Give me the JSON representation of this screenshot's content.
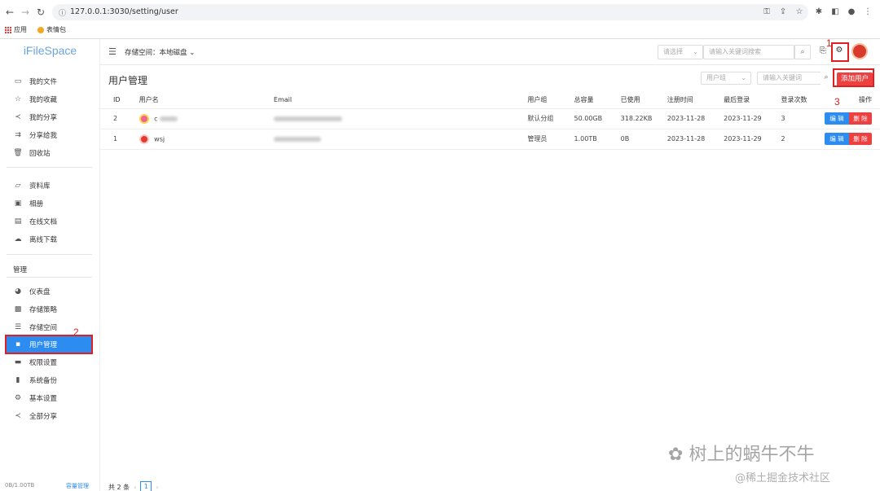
{
  "browser": {
    "url": "127.0.0.1:3030/setting/user",
    "bookmarks": [
      {
        "label": "应用"
      },
      {
        "label": "表情包"
      }
    ]
  },
  "sidebar": {
    "logo": "iFileSpace",
    "group1": [
      {
        "label": "我的文件",
        "icon": "folder-icon"
      },
      {
        "label": "我的收藏",
        "icon": "star-icon"
      },
      {
        "label": "我的分享",
        "icon": "share-icon"
      },
      {
        "label": "分享给我",
        "icon": "shared-with-me-icon"
      },
      {
        "label": "回收站",
        "icon": "trash-icon"
      }
    ],
    "group2": [
      {
        "label": "资料库",
        "icon": "folder-open-icon"
      },
      {
        "label": "相册",
        "icon": "image-icon"
      },
      {
        "label": "在线文档",
        "icon": "document-icon"
      },
      {
        "label": "离线下载",
        "icon": "cloud-download-icon"
      }
    ],
    "admin_title": "管理",
    "admin": [
      {
        "label": "仪表盘",
        "icon": "dashboard-icon"
      },
      {
        "label": "存储策略",
        "icon": "storage-policy-icon"
      },
      {
        "label": "存储空间",
        "icon": "storage-space-icon"
      },
      {
        "label": "用户管理",
        "icon": "user-management-icon"
      },
      {
        "label": "权限设置",
        "icon": "permission-icon"
      },
      {
        "label": "系统备份",
        "icon": "backup-icon"
      },
      {
        "label": "基本设置",
        "icon": "settings-icon"
      },
      {
        "label": "全部分享",
        "icon": "all-shares-icon"
      }
    ],
    "footer_usage": "0B/1.00TB",
    "footer_link": "容量管理"
  },
  "header": {
    "storage_label": "存储空间：本地磁盘",
    "select_placeholder": "请选择",
    "search_placeholder": "请输入关键词搜索"
  },
  "main": {
    "title": "用户管理",
    "group_filter_placeholder": "用户组",
    "keyword_placeholder": "请输入关键词",
    "add_button": "添加用户",
    "columns": [
      "ID",
      "用户名",
      "Email",
      "用户组",
      "总容量",
      "已使用",
      "注册时间",
      "最后登录",
      "登录次数",
      "操作"
    ],
    "rows": [
      {
        "id": "2",
        "name": "c",
        "group": "默认分组",
        "total": "50.00GB",
        "used": "318.22KB",
        "registered": "2023-11-28",
        "last_login": "2023-11-29",
        "logins": "3"
      },
      {
        "id": "1",
        "name": "wsj",
        "group": "管理员",
        "total": "1.00TB",
        "used": "0B",
        "registered": "2023-11-28",
        "last_login": "2023-11-29",
        "logins": "2"
      }
    ],
    "edit_label": "编 辑",
    "delete_label": "删 除",
    "total_text": "共 2 条",
    "current_page": "1"
  },
  "annotations": {
    "n1": "1",
    "n2": "2",
    "n3": "3"
  },
  "watermark": {
    "line1": "树上的蜗牛不牛",
    "line2": "@稀土掘金技术社区"
  },
  "colors": {
    "primary": "#2d8cf0",
    "danger": "#ed4040",
    "annotation": "#e02020"
  }
}
